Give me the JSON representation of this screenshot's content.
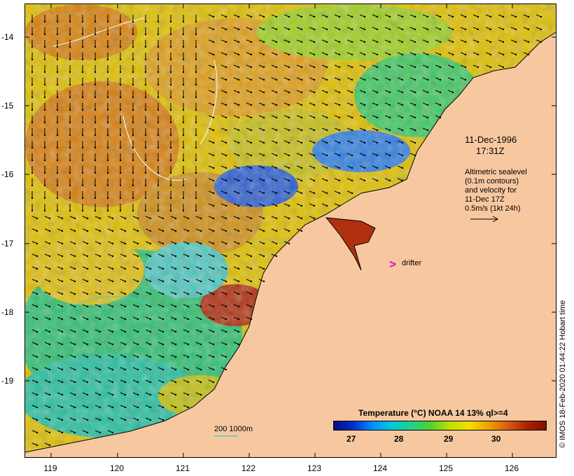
{
  "axes": {
    "y_ticks": [
      "-14",
      "-15",
      "-16",
      "-17",
      "-18",
      "-19"
    ],
    "x_ticks": [
      "119",
      "120",
      "121",
      "122",
      "123",
      "124",
      "125",
      "126"
    ]
  },
  "annotation": {
    "date": "11-Dec-1996",
    "time": "17:31Z",
    "altimetry": "Altimetric sealevel\n(0.1m contours)\nand velocity for\n11-Dec 17Z\n0.5m/s (1kt 24h)"
  },
  "drifter": {
    "symbol": ">",
    "label": "drifter"
  },
  "isobath_label": "200  1000m",
  "legend": {
    "title": "Temperature (°C) NOAA 14 13% ql>=4",
    "ticks": [
      "27",
      "28",
      "29",
      "30"
    ]
  },
  "credit": "© IMOS 18-Feb-2020 01:44:22 Hobart time",
  "colors": {
    "land": "#f7c8a0",
    "drifter": "#e000e0",
    "isobath": "#40d0c0",
    "contour": "#ffffff"
  }
}
